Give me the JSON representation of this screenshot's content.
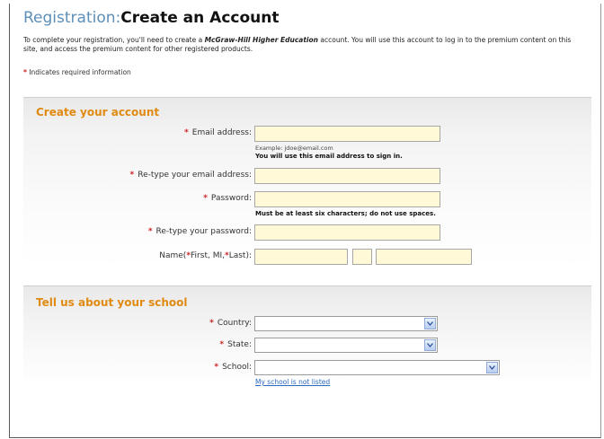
{
  "header": {
    "title_prefix": "Registration",
    "title_sep": ":",
    "title_main": "Create an Account"
  },
  "intro": {
    "part1": "To complete your registration, you'll need to create a ",
    "brand": "McGraw-Hill Higher Education",
    "part2": " account. You will use this account to log in to the premium content on this site, and access the premium content for other registered products."
  },
  "required_note": {
    "star": "*",
    "text": "Indicates required information"
  },
  "account_section": {
    "title": "Create your account",
    "email": {
      "label": "Email address:",
      "value": "",
      "hint_example": "Example: jdoe@email.com",
      "hint_note": "You will use this email address to sign in."
    },
    "email_confirm": {
      "label": "Re-type your email address:",
      "value": ""
    },
    "password": {
      "label": "Password:",
      "value": "",
      "hint": "Must be at least six characters; do not use spaces."
    },
    "password_confirm": {
      "label": "Re-type your password:",
      "value": ""
    },
    "name": {
      "label_prefix": "Name(",
      "star1": "*",
      "label_first": "First, MI,",
      "star2": "*",
      "label_last": "Last):",
      "first": "",
      "mi": "",
      "last": ""
    }
  },
  "school_section": {
    "title": "Tell us about your school",
    "country": {
      "label": "Country:",
      "selected": ""
    },
    "state": {
      "label": "State:",
      "selected": ""
    },
    "school": {
      "label": "School:",
      "selected": ""
    },
    "not_listed_link": "My school is not listed"
  },
  "icons": {
    "dropdown": "chevron-down-icon"
  }
}
